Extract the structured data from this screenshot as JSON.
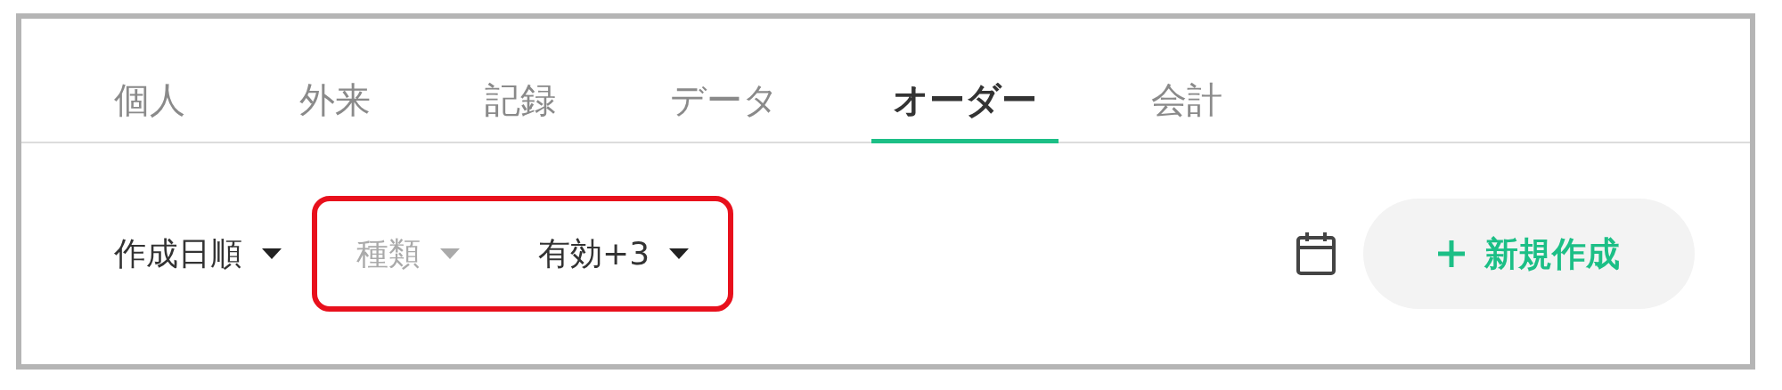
{
  "tabs": [
    {
      "label": "個人",
      "selected": false
    },
    {
      "label": "外来",
      "selected": false
    },
    {
      "label": "記録",
      "selected": false
    },
    {
      "label": "データ",
      "selected": false
    },
    {
      "label": "オーダー",
      "selected": true
    },
    {
      "label": "会計",
      "selected": false
    }
  ],
  "sort_dropdown": {
    "label": "作成日順",
    "disabled": false
  },
  "filters": [
    {
      "label": "種類",
      "disabled": true
    },
    {
      "label": "有効+3",
      "disabled": false
    }
  ],
  "new_button": {
    "label": "新規作成"
  }
}
